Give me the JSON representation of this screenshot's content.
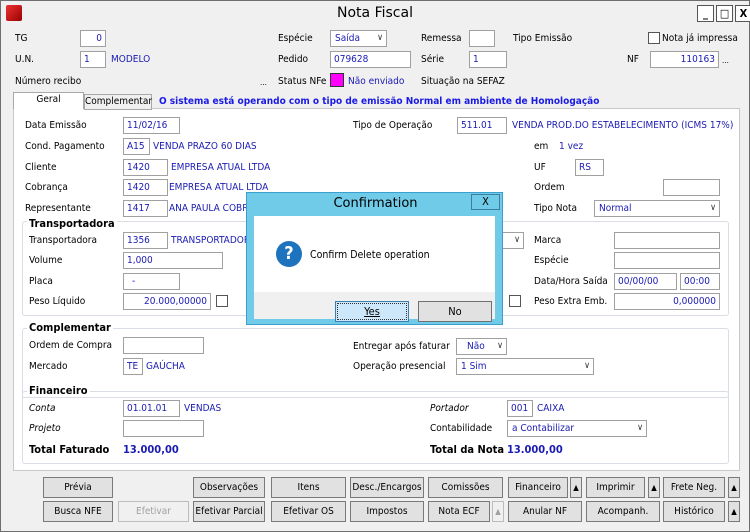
{
  "window": {
    "title": "Nota Fiscal",
    "minimize": "_",
    "maximize": "□",
    "close": "X"
  },
  "header": {
    "tg_label": "TG",
    "tg_value": "0",
    "especie_label": "Espécie",
    "especie_value": "Saída",
    "remessa_label": "Remessa",
    "remessa_value": "",
    "tipo_emissao_label": "Tipo Emissão",
    "nota_impressa_label": "Nota já impressa",
    "nota_impressa_checked": false,
    "un_label": "U.N.",
    "un_value": "1",
    "un_name": "MODELO",
    "pedido_label": "Pedido",
    "pedido_value": "079628",
    "serie_label": "Série",
    "serie_value": "1",
    "nf_label": "NF",
    "nf_value": "110163",
    "ellipsis": "...",
    "numero_recibo_label": "Número recibo",
    "status_nfe_label": "Status NFe",
    "status_nfe_value": "Não enviado",
    "status_color": "#ff00ff",
    "situacao_label": "Situação na SEFAZ"
  },
  "tabs": [
    {
      "label": "Geral",
      "active": true
    },
    {
      "label": "Complementar",
      "active": false
    }
  ],
  "notice": "O sistema está operando com o tipo de emissão Normal em ambiente de Homologação",
  "geral": {
    "data_emissao_label": "Data Emissão",
    "data_emissao": "11/02/16",
    "tipo_operacao_label": "Tipo de Operação",
    "tipo_operacao_code": "511.01",
    "tipo_operacao_desc": "VENDA PROD.DO ESTABELECIMENTO (ICMS 17%)",
    "cond_pag_label": "Cond. Pagamento",
    "cond_pag_code": "A15",
    "cond_pag_desc": "VENDA PRAZO 60 DIAS",
    "em_label": "em",
    "em_value": "1 vez",
    "cliente_label": "Cliente",
    "cliente_code": "1420",
    "cliente_desc": "EMPRESA ATUAL LTDA",
    "uf_label": "UF",
    "uf_value": "RS",
    "cobranca_label": "Cobrança",
    "cobranca_code": "1420",
    "cobranca_desc": "EMPRESA ATUAL LTDA",
    "ordem_label": "Ordem",
    "ordem_value": "",
    "representante_label": "Representante",
    "representante_code": "1417",
    "representante_desc": "ANA PAULA COBRA",
    "tipo_nota_label": "Tipo Nota",
    "tipo_nota_value": "Normal"
  },
  "transportadora": {
    "title": "Transportadora",
    "transp_label": "Transportadora",
    "transp_code": "1356",
    "transp_desc": "TRANSPORTADOR",
    "marca_label": "Marca",
    "volume_label": "Volume",
    "volume_value": "1,000",
    "especie_label": "Espécie",
    "placa_label": "Placa",
    "placa_value": "-",
    "data_hora_label": "Data/Hora Saída",
    "data_saida": "00/00/00",
    "hora_saida": "00:00",
    "peso_liquido_label": "Peso Líquido",
    "peso_liquido": "20.000,00000",
    "peso_extra_label": "Peso Extra Emb.",
    "peso_extra": "0,000000"
  },
  "complementar": {
    "title": "Complementar",
    "ordem_compra_label": "Ordem de Compra",
    "entregar_label": "Entregar após faturar",
    "entregar_value": "Não",
    "mercado_label": "Mercado",
    "mercado_code": "TE",
    "mercado_desc": "GAÚCHA",
    "operacao_label": "Operação presencial",
    "operacao_value": "1 Sim"
  },
  "financeiro": {
    "title": "Financeiro",
    "conta_label": "Conta",
    "conta_code": "01.01.01",
    "conta_desc": "VENDAS",
    "portador_label": "Portador",
    "portador_code": "001",
    "portador_desc": "CAIXA",
    "projeto_label": "Projeto",
    "contabilidade_label": "Contabilidade",
    "contabilidade_value": "a Contabilizar",
    "total_faturado_label": "Total Faturado",
    "total_faturado": "13.000,00",
    "total_nota_label": "Total da Nota",
    "total_nota": "13.000,00"
  },
  "buttons": {
    "previa": "Prévia",
    "observacoes": "Observações",
    "itens": "Itens",
    "desc_encargos": "Desc./Encargos",
    "comissoes": "Comissões",
    "financeiro": "Financeiro",
    "imprimir": "Imprimir",
    "frete": "Frete Neg.",
    "busca_nfe": "Busca NFE",
    "efetivar": "Efetivar",
    "efetivar_parcial": "Efetivar Parcial",
    "efetivar_os": "Efetivar OS",
    "impostos": "Impostos",
    "nota_ecf": "Nota ECF",
    "anular_nf": "Anular NF",
    "acompanh": "Acompanh.",
    "historico": "Histórico",
    "arrow": "▲"
  },
  "dialog": {
    "title": "Confirmation",
    "close": "X",
    "message": "Confirm Delete operation",
    "icon": "question-icon",
    "yes": "Yes",
    "no": "No"
  }
}
